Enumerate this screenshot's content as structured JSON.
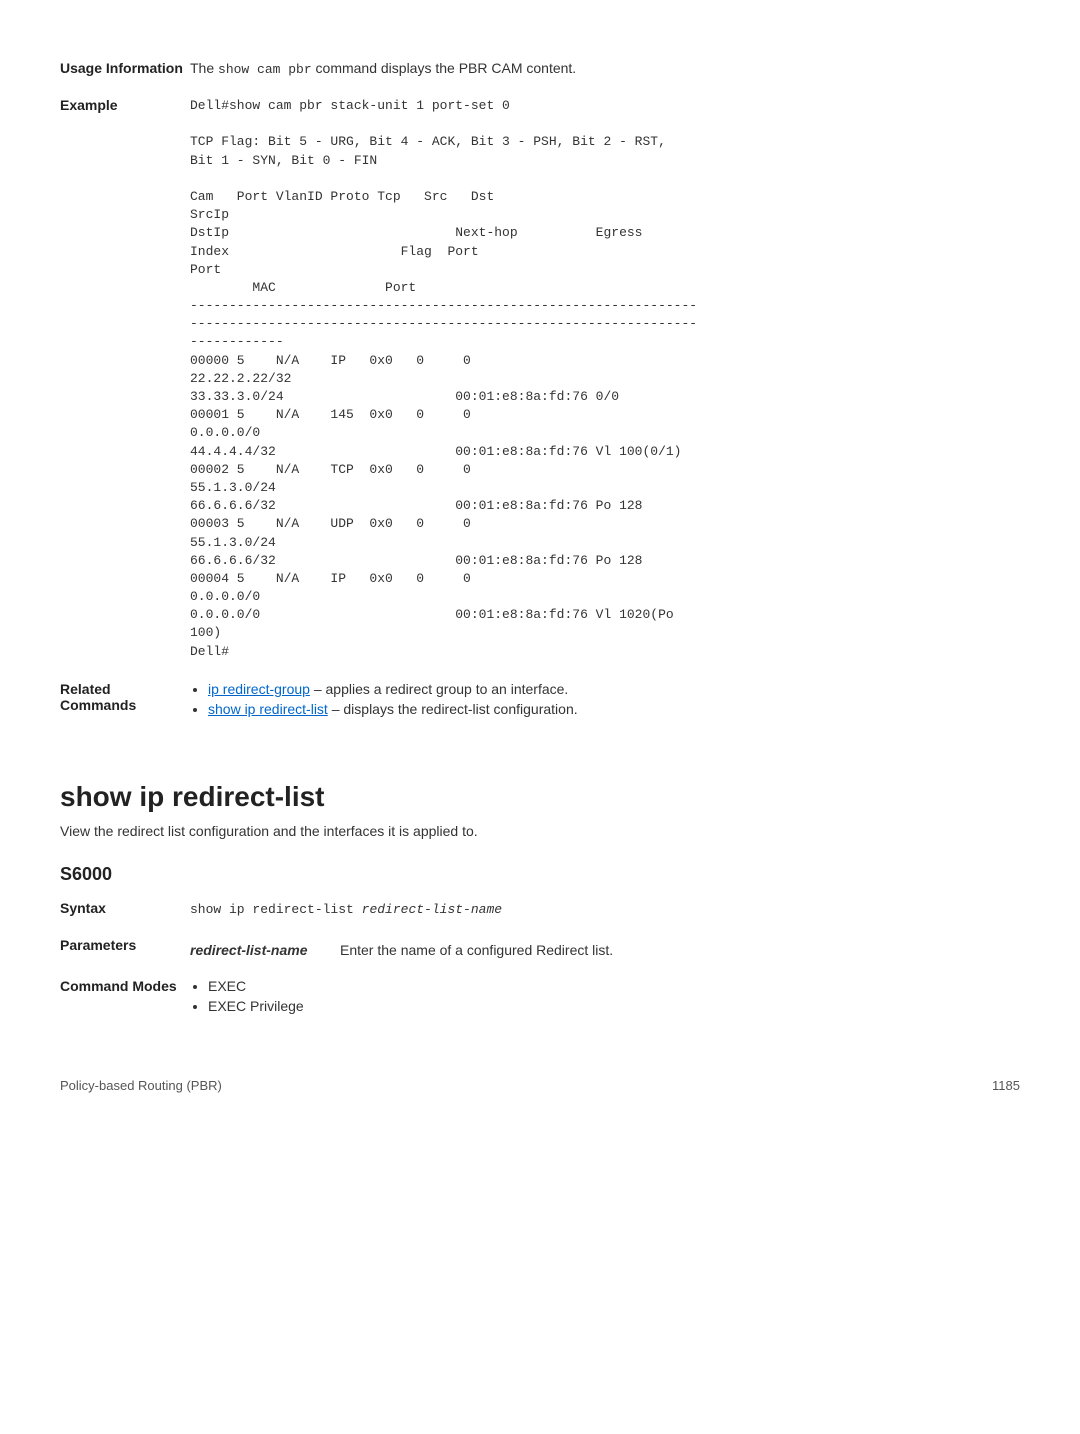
{
  "usage": {
    "label": "Usage Information",
    "text_pre": "The ",
    "text_cmd": "show cam pbr",
    "text_post": " command displays the PBR CAM content."
  },
  "example": {
    "label": "Example",
    "block": "Dell#show cam pbr stack-unit 1 port-set 0\n\nTCP Flag: Bit 5 - URG, Bit 4 - ACK, Bit 3 - PSH, Bit 2 - RST, \nBit 1 - SYN, Bit 0 - FIN\n\nCam   Port VlanID Proto Tcp   Src   Dst \nSrcIp                       \nDstIp                             Next-hop          Egress\nIndex                      Flag  Port  \nPort          \n        MAC              Port\n-----------------------------------------------------------------\n-----------------------------------------------------------------\n------------\n00000 5    N/A    IP   0x0   0     0     \n22.22.2.22/32                \n33.33.3.0/24                      00:01:e8:8a:fd:76 0/0\n00001 5    N/A    145  0x0   0     0     \n0.0.0.0/0                    \n44.4.4.4/32                       00:01:e8:8a:fd:76 Vl 100(0/1)\n00002 5    N/A    TCP  0x0   0     0     \n55.1.3.0/24                  \n66.6.6.6/32                       00:01:e8:8a:fd:76 Po 128\n00003 5    N/A    UDP  0x0   0     0     \n55.1.3.0/24                  \n66.6.6.6/32                       00:01:e8:8a:fd:76 Po 128\n00004 5    N/A    IP   0x0   0     0     \n0.0.0.0/0                    \n0.0.0.0/0                         00:01:e8:8a:fd:76 Vl 1020(Po \n100)\nDell#"
  },
  "related": {
    "label": "Related Commands",
    "items": [
      {
        "link": "ip redirect-group",
        "text": " – applies a redirect group to an interface."
      },
      {
        "link": "show ip redirect-list",
        "text": " – displays the redirect-list configuration."
      }
    ]
  },
  "command": {
    "title": "show ip redirect-list",
    "desc": "View the redirect list configuration and the interfaces it is applied to.",
    "model": "S6000"
  },
  "syntax": {
    "label": "Syntax",
    "line_cmd": "show ip redirect-list ",
    "line_arg": "redirect-list-name"
  },
  "parameters": {
    "label": "Parameters",
    "param_name": "redirect-list-name",
    "param_desc": "Enter the name of a configured Redirect list."
  },
  "modes": {
    "label": "Command Modes",
    "items": [
      "EXEC",
      "EXEC Privilege"
    ]
  },
  "footer": {
    "left": "Policy-based Routing (PBR)",
    "right": "1185"
  }
}
